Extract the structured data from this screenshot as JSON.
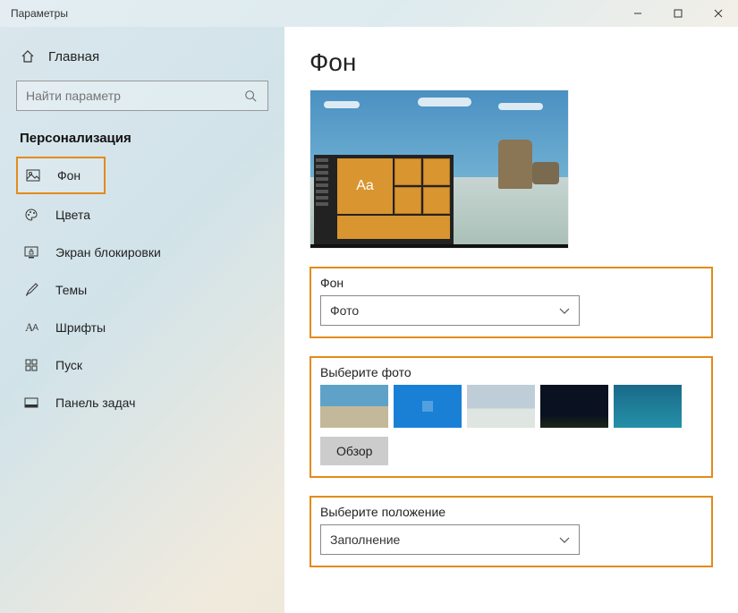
{
  "window": {
    "title": "Параметры"
  },
  "sidebar": {
    "home": "Главная",
    "search_placeholder": "Найти параметр",
    "section": "Персонализация",
    "items": [
      {
        "icon": "picture",
        "label": "Фон",
        "selected": true
      },
      {
        "icon": "palette",
        "label": "Цвета"
      },
      {
        "icon": "lock",
        "label": "Экран блокировки"
      },
      {
        "icon": "brush",
        "label": "Темы"
      },
      {
        "icon": "font",
        "label": "Шрифты"
      },
      {
        "icon": "start",
        "label": "Пуск"
      },
      {
        "icon": "taskbar",
        "label": "Панель задач"
      }
    ]
  },
  "main": {
    "heading": "Фон",
    "preview_sample_text": "Aa",
    "background_section": {
      "label": "Фон",
      "selected": "Фото"
    },
    "choose_photo": {
      "label": "Выберите фото",
      "browse": "Обзор"
    },
    "position": {
      "label": "Выберите положение",
      "selected": "Заполнение"
    }
  }
}
